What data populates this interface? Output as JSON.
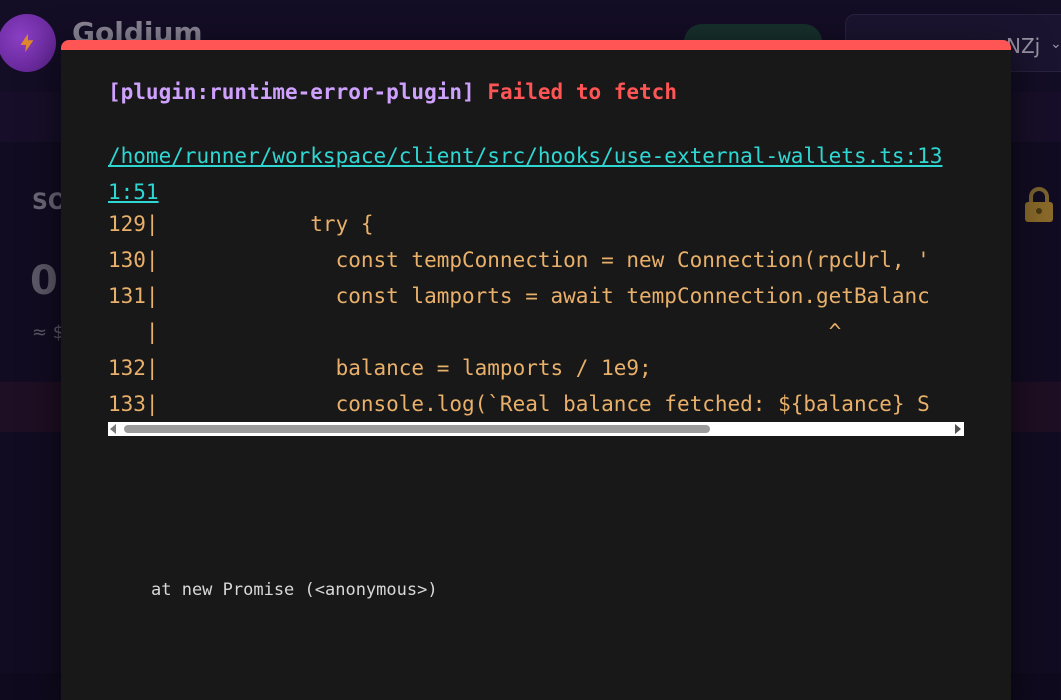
{
  "app": {
    "name": "Goldium",
    "wallet_label": "NZj",
    "card_title": "SO",
    "card_amount": "0.",
    "card_approx": "≈ $"
  },
  "error": {
    "plugin": "[plugin:runtime-error-plugin]",
    "message": "Failed to fetch",
    "file": "/home/runner/workspace/client/src/hooks/use-external-wallets.ts:131:51",
    "code_lines": [
      "129|            try {",
      "130|              const tempConnection = new Connection(rpcUrl, '",
      "131|              const lamports = await tempConnection.getBalanc",
      "   |                                                     ^",
      "132|              balance = lamports / 1e9;",
      "133|              console.log(`Real balance fetched: ${balance} S"
    ],
    "stack": "at new Promise (<anonymous>)"
  },
  "colors": {
    "overlay_border": "#ff5555",
    "plugin": "#cfa1ff",
    "message": "#ff5555",
    "file_link": "#2fd7d3",
    "code": "#e8b06a"
  }
}
